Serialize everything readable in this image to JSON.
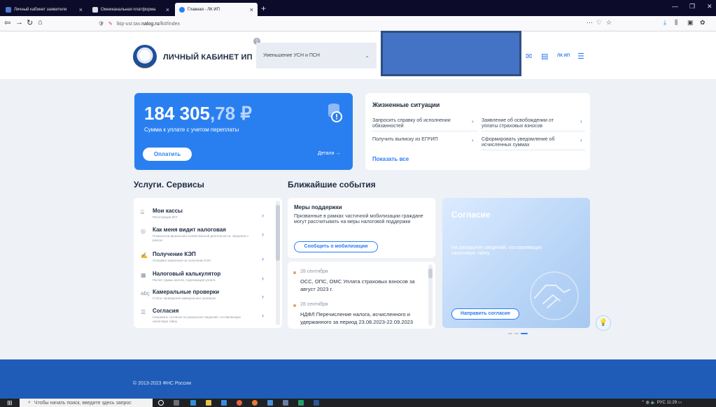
{
  "browser": {
    "tabs": [
      {
        "label": "Личный кабинет заявителя",
        "active": false
      },
      {
        "label": "Омниканальная платформа",
        "active": false
      },
      {
        "label": "Главная - ЛК ИП",
        "active": true
      }
    ],
    "url_prefix": "lkip-usr.tax.",
    "url_host": "nalog.ru",
    "url_path": "/lk#/index"
  },
  "header": {
    "brand": "ЛИЧНЫЙ КАБИНЕТ ИП",
    "regime_badge": "0",
    "regime": "Уменьшение УСН и ПСН",
    "lk_label": "ЛК ИП"
  },
  "balance": {
    "amount_int": "184 305",
    "amount_frac": ",78 ₽",
    "caption": "Сумма к уплате с учетом переплаты",
    "pay_button": "Оплатить",
    "details": "Детали →"
  },
  "life": {
    "title": "Жизненные ситуации",
    "items": [
      "Запросить справку об исполнении обязанностей",
      "Заявление об освобождении от уплаты страховых взносов",
      "Получить выписку из ЕГРИП",
      "Сформировать уведомление об исчисленных суммах"
    ],
    "show_all": "Показать все"
  },
  "sections": {
    "services": "Услуги. Сервисы",
    "events": "Ближайшие события"
  },
  "services": [
    {
      "icon": "cash-register-icon",
      "glyph": "⌸",
      "name": "Мои кассы",
      "desc": "Регистрация ККТ"
    },
    {
      "icon": "eye-icon",
      "glyph": "◎",
      "name": "Как меня видит налоговая",
      "desc": "Показатели финансово-хозяйственной деятельности, сведения о рисках"
    },
    {
      "icon": "signature-icon",
      "glyph": "✍",
      "name": "Получение КЭП",
      "desc": "Отправка заявления на получение КЭП"
    },
    {
      "icon": "calculator-icon",
      "glyph": "▦",
      "name": "Налоговый калькулятор",
      "desc": "Расчет суммы налога, подлежащей уплате"
    },
    {
      "icon": "audit-icon",
      "glyph": "abç",
      "name": "Камеральные проверки",
      "desc": "Статус проведения камеральных проверок"
    },
    {
      "icon": "consent-list-icon",
      "glyph": "☰",
      "name": "Согласия",
      "desc": "Направить согласие на раскрытие сведений, составляющих налоговую тайну"
    }
  ],
  "support": {
    "title": "Меры поддержки",
    "text": "Призванные в рамках частичной мобилизации граждане могут рассчитывать на меры налоговой поддержки",
    "button": "Сообщить о мобилизации"
  },
  "events": [
    {
      "date": "28 сентября",
      "text": "ОСС, ОПС, ОМС Уплата страховых взносов за август 2023 г."
    },
    {
      "date": "28 сентября",
      "text": "НДФЛ Перечисление налога, исчисленного и удержанного за период 23.08.2023-22.09.2023"
    }
  ],
  "consent": {
    "title": "Согласие",
    "text": "На раскрытие сведений, составляющих налоговую тайну",
    "button": "Направить согласие"
  },
  "footer": {
    "copyright": "© 2013-2023 ФНС России"
  },
  "taskbar": {
    "search_placeholder": "Чтобы начать поиск, введите здесь запрос",
    "tray_text": "РУС",
    "time": "11:29"
  },
  "colors": {
    "accent": "#2d7cf6",
    "balance_card": "#2a7ff0",
    "footer": "#1f5cb8",
    "redaction": "#4472c4"
  }
}
